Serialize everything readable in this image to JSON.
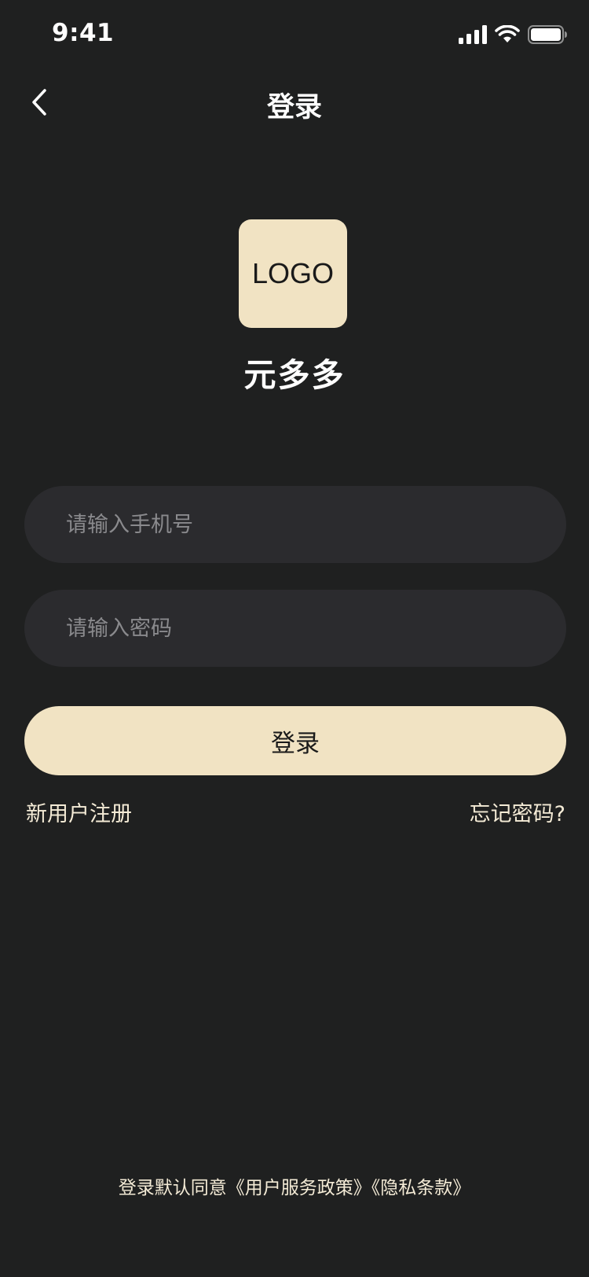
{
  "status_bar": {
    "time": "9:41",
    "icons": [
      "cellular-signal-icon",
      "wifi-icon",
      "battery-icon"
    ]
  },
  "nav": {
    "back_icon": "chevron-left-icon",
    "title": "登录"
  },
  "brand": {
    "logo_text": "LOGO",
    "app_name": "元多多",
    "logo_color": "#f1e3c3"
  },
  "form": {
    "phone_placeholder": "请输入手机号",
    "phone_value": "",
    "password_placeholder": "请输入密码",
    "password_value": "",
    "login_button_label": "登录"
  },
  "links": {
    "register": "新用户注册",
    "forgot_password": "忘记密码?"
  },
  "agreement": {
    "prefix": "登录默认同意",
    "service_policy": "《用户服务政策》",
    "privacy_terms": "《隐私条款》"
  },
  "colors": {
    "background": "#1f2020",
    "input_background": "#2b2b2e",
    "accent": "#f1e3c3",
    "link_text": "#f4ebd6"
  }
}
